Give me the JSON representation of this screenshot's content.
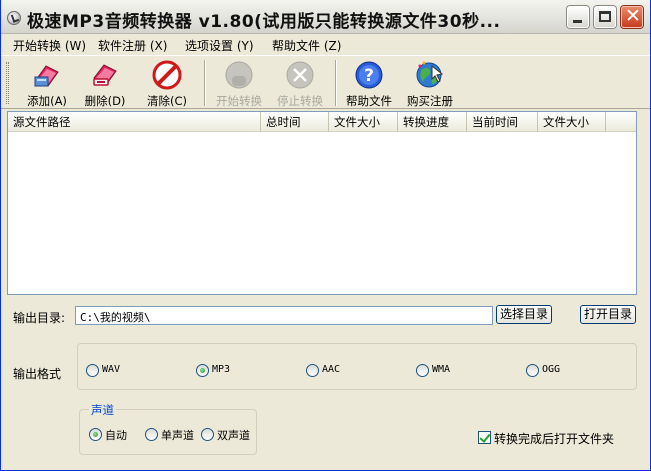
{
  "window": {
    "title": "极速MP3音频转换器  v1.80(试用版只能转换源文件30秒...",
    "close_glyph": "✕"
  },
  "menu": [
    {
      "label": "开始转换 (W)"
    },
    {
      "label": "软件注册 (X)"
    },
    {
      "label": "选项设置 (Y)"
    },
    {
      "label": "帮助文件 (Z)"
    }
  ],
  "toolbar": [
    {
      "label": "添加(A)",
      "icon": "add-files-icon",
      "enabled": true
    },
    {
      "label": "删除(D)",
      "icon": "delete-file-icon",
      "enabled": true
    },
    {
      "label": "清除(C)",
      "icon": "clear-list-icon",
      "enabled": true
    },
    {
      "label": "开始转换",
      "icon": "start-convert-icon",
      "enabled": false
    },
    {
      "label": "停止转换",
      "icon": "stop-convert-icon",
      "enabled": false
    },
    {
      "label": "帮助文件",
      "icon": "help-icon",
      "enabled": true
    },
    {
      "label": "购买注册",
      "icon": "buy-register-icon",
      "enabled": true
    }
  ],
  "file_list": {
    "columns": [
      "源文件路径",
      "总时间",
      "文件大小",
      "转换进度",
      "当前时间",
      "文件大小"
    ],
    "rows": []
  },
  "output": {
    "dir_label": "输出目录:",
    "dir_value": "C:\\我的视频\\",
    "choose_dir_button": "选择目录",
    "open_dir_button": "打开目录",
    "format_label": "输出格式",
    "formats": [
      {
        "label": "WAV",
        "selected": false
      },
      {
        "label": "MP3",
        "selected": true
      },
      {
        "label": "AAC",
        "selected": false
      },
      {
        "label": "WMA",
        "selected": false
      },
      {
        "label": "OGG",
        "selected": false
      }
    ]
  },
  "channel": {
    "legend": "声道",
    "options": [
      {
        "label": "自动",
        "selected": true
      },
      {
        "label": "单声道",
        "selected": false
      },
      {
        "label": "双声道",
        "selected": false
      }
    ]
  },
  "open_folder_after": {
    "label": "转换完成后打开文件夹",
    "checked": true
  },
  "colors": {
    "window_bg": "#ece9d8",
    "accent_blue": "#0046d5",
    "close_red": "#c73c1f"
  }
}
